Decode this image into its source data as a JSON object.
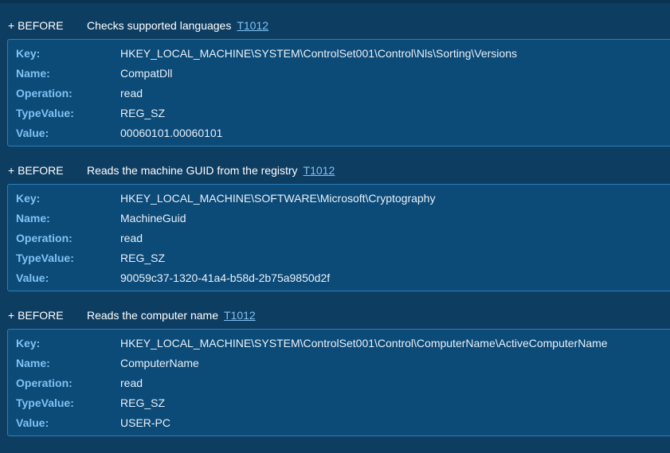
{
  "entries": [
    {
      "toggle": "+ BEFORE",
      "description": "Checks supported languages",
      "technique": "T1012",
      "fields": [
        {
          "label": "Key:",
          "value": "HKEY_LOCAL_MACHINE\\SYSTEM\\ControlSet001\\Control\\Nls\\Sorting\\Versions"
        },
        {
          "label": "Name:",
          "value": "CompatDll"
        },
        {
          "label": "Operation:",
          "value": "read"
        },
        {
          "label": "TypeValue:",
          "value": "REG_SZ"
        },
        {
          "label": "Value:",
          "value": "00060101.00060101"
        }
      ]
    },
    {
      "toggle": "+ BEFORE",
      "description": "Reads the machine GUID from the registry",
      "technique": "T1012",
      "fields": [
        {
          "label": "Key:",
          "value": "HKEY_LOCAL_MACHINE\\SOFTWARE\\Microsoft\\Cryptography"
        },
        {
          "label": "Name:",
          "value": "MachineGuid"
        },
        {
          "label": "Operation:",
          "value": "read"
        },
        {
          "label": "TypeValue:",
          "value": "REG_SZ"
        },
        {
          "label": "Value:",
          "value": "90059c37-1320-41a4-b58d-2b75a9850d2f"
        }
      ]
    },
    {
      "toggle": "+ BEFORE",
      "description": "Reads the computer name",
      "technique": "T1012",
      "fields": [
        {
          "label": "Key:",
          "value": "HKEY_LOCAL_MACHINE\\SYSTEM\\ControlSet001\\Control\\ComputerName\\ActiveComputerName"
        },
        {
          "label": "Name:",
          "value": "ComputerName"
        },
        {
          "label": "Operation:",
          "value": "read"
        },
        {
          "label": "TypeValue:",
          "value": "REG_SZ"
        },
        {
          "label": "Value:",
          "value": "USER-PC"
        }
      ]
    }
  ],
  "colors": {
    "background": "#0e3d62",
    "box": "#0c4a78",
    "border": "#2d7fba",
    "label": "#7ec3f3",
    "link": "#7ec3f3"
  }
}
